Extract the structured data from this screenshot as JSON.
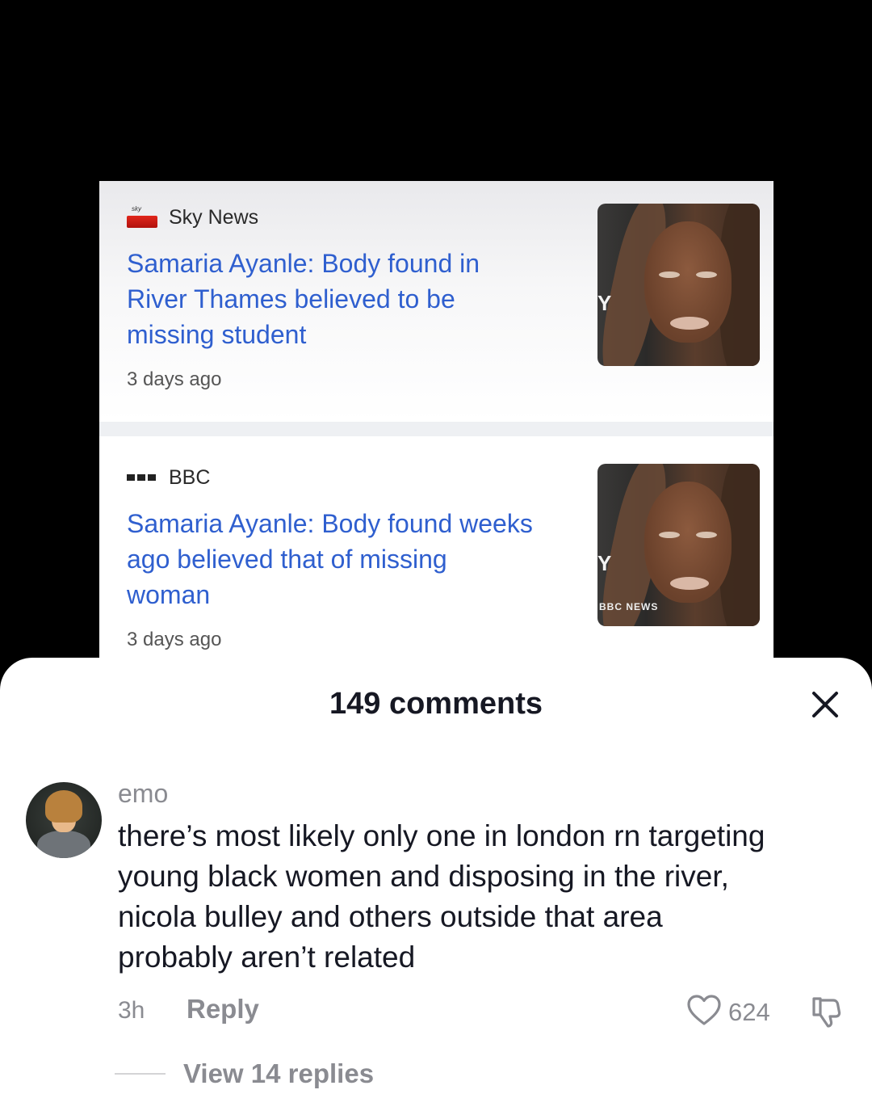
{
  "news": {
    "items": [
      {
        "source": "Sky News",
        "headline_lines": [
          "Samaria Ayanle: Body found in",
          "River Thames believed to be",
          "missing student"
        ],
        "timestamp": "3 days ago",
        "logo_icon": "sky-news-logo",
        "logo_top_text": "sky"
      },
      {
        "source": "BBC",
        "headline_lines": [
          "Samaria Ayanle: Body found weeks",
          "ago believed that of missing",
          "woman"
        ],
        "timestamp": "3 days ago",
        "logo_icon": "bbc-logo",
        "thumb_bug": "BBC NEWS"
      }
    ]
  },
  "comments_sheet": {
    "title": "149 comments",
    "close_icon": "close-icon",
    "comment": {
      "username": "emo",
      "text_lines": [
        "there’s most likely only one in london rn targeting",
        "young black women and disposing in the river,",
        "nicola bulley and others outside that area",
        "probably aren’t related"
      ],
      "time": "3h",
      "reply_label": "Reply",
      "like_count": "624",
      "like_icon": "heart-icon",
      "dislike_icon": "thumbs-down-icon",
      "view_replies_label": "View 14 replies"
    }
  }
}
